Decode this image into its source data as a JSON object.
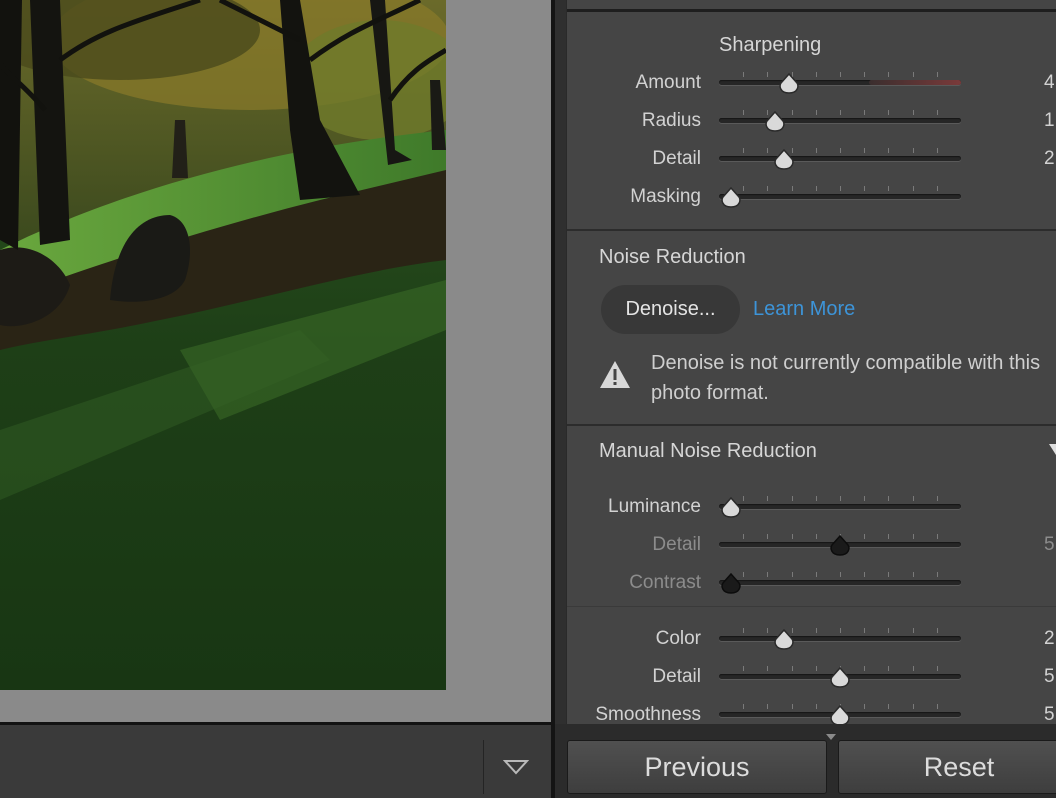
{
  "sharpening": {
    "title": "Sharpening",
    "sliders": [
      {
        "label": "Amount",
        "value": "4",
        "position": 0.29
      },
      {
        "label": "Radius",
        "value": "1,",
        "position": 0.23
      },
      {
        "label": "Detail",
        "value": "2",
        "position": 0.27
      },
      {
        "label": "Masking",
        "value": "",
        "position": 0.05
      }
    ]
  },
  "noise_reduction": {
    "title": "Noise Reduction",
    "denoise_label": "Denoise...",
    "learn_more_label": "Learn More",
    "warning_text": "Denoise is not currently compatible with this photo format.",
    "warning_icon": "warning-triangle-icon"
  },
  "manual_noise_reduction": {
    "title": "Manual Noise Reduction",
    "luminance_group": [
      {
        "label": "Luminance",
        "value": "",
        "position": 0.05,
        "dim": false
      },
      {
        "label": "Detail",
        "value": "5",
        "position": 0.5,
        "dim": true
      },
      {
        "label": "Contrast",
        "value": "",
        "position": 0.05,
        "dim": true
      }
    ],
    "color_group": [
      {
        "label": "Color",
        "value": "2",
        "position": 0.27
      },
      {
        "label": "Detail",
        "value": "5",
        "position": 0.5
      },
      {
        "label": "Smoothness",
        "value": "5",
        "position": 0.5
      }
    ]
  },
  "buttons": {
    "previous": "Previous",
    "reset": "Reset"
  },
  "colors": {
    "accent_link": "#3d94d8",
    "panel_bg": "#454545"
  }
}
